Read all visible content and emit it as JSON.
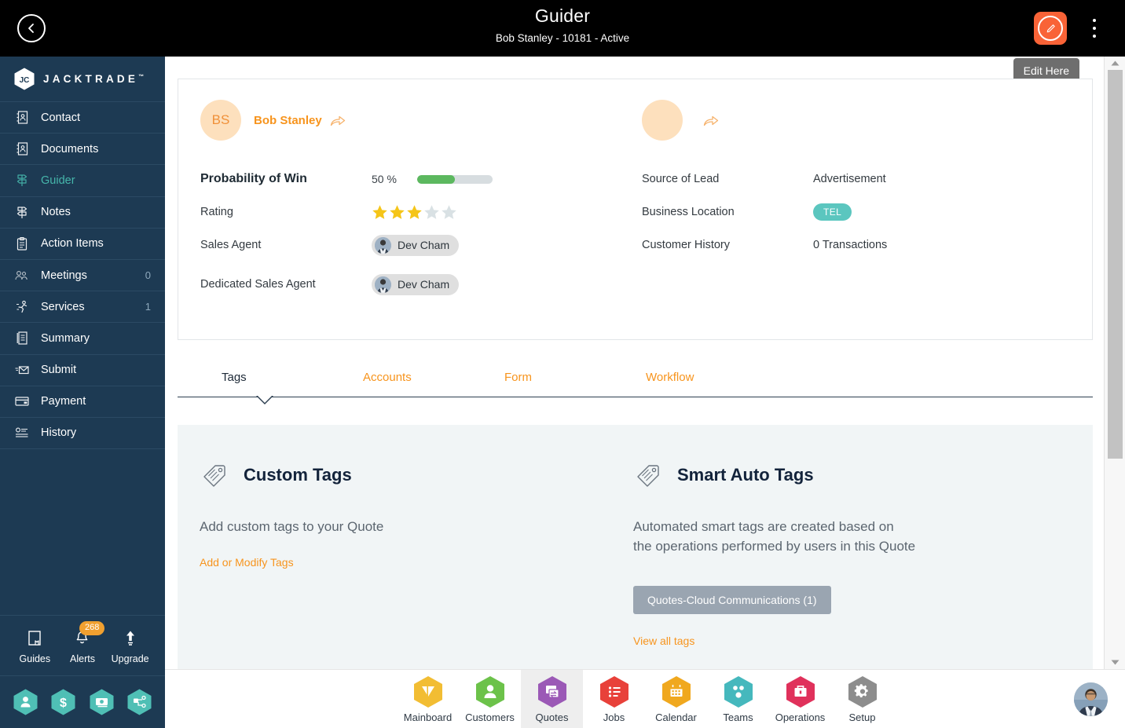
{
  "topbar": {
    "back_icon": "chevron-left-circle-icon",
    "title": "Guider",
    "subtitle": "Bob Stanley - 10181 - Active",
    "edit_icon": "pencil-circle-icon",
    "menu_icon": "kebab-menu-icon",
    "edit_highlight_color": "#f96337"
  },
  "tooltip": {
    "edit_here": "Edit Here"
  },
  "sidebar": {
    "brand": "JACKTRADE",
    "brand_tm": "™",
    "accent_active": "#46b6ab",
    "background": "#1d3a53",
    "items": [
      {
        "label": "Contact",
        "icon": "contact-book-icon",
        "count": "",
        "active": false
      },
      {
        "label": "Documents",
        "icon": "documents-icon",
        "count": "",
        "active": false
      },
      {
        "label": "Guider",
        "icon": "signpost-icon",
        "count": "",
        "active": true
      },
      {
        "label": "Notes",
        "icon": "signpost-icon",
        "count": "",
        "active": false
      },
      {
        "label": "Action Items",
        "icon": "clipboard-icon",
        "count": "",
        "active": false
      },
      {
        "label": "Meetings",
        "icon": "meetings-icon",
        "count": "0",
        "active": false
      },
      {
        "label": "Services",
        "icon": "services-runner-icon",
        "count": "1",
        "active": false
      },
      {
        "label": "Summary",
        "icon": "summary-doc-icon",
        "count": "",
        "active": false
      },
      {
        "label": "Submit",
        "icon": "submit-envelope-icon",
        "count": "",
        "active": false
      },
      {
        "label": "Payment",
        "icon": "payment-card-icon",
        "count": "",
        "active": false
      },
      {
        "label": "History",
        "icon": "history-list-icon",
        "count": "",
        "active": false
      }
    ],
    "tools": [
      {
        "label": "Guides",
        "icon": "book-icon",
        "badge": ""
      },
      {
        "label": "Alerts",
        "icon": "bell-icon",
        "badge": "268"
      },
      {
        "label": "Upgrade",
        "icon": "upward-arrow-icon",
        "badge": ""
      }
    ],
    "quick_hexes": [
      {
        "icon": "person-icon"
      },
      {
        "icon": "dollar-icon"
      },
      {
        "icon": "money-transfer-icon"
      },
      {
        "icon": "workflow-nodes-icon"
      }
    ]
  },
  "card": {
    "person": {
      "initials": "BS",
      "name": "Bob Stanley",
      "share_icon": "share-arrow-icon",
      "avatar_bg": "#fde0bd"
    },
    "person_secondary": {
      "initials": "",
      "name": "",
      "share_icon": "share-arrow-icon"
    },
    "left_fields": [
      {
        "label": "Probability of Win",
        "type": "progress",
        "value_text": "50 %",
        "percent": 50,
        "bar_color": "#5cb85f"
      },
      {
        "label": "Rating",
        "type": "stars",
        "filled": 3,
        "total": 5,
        "star_color": "#f5c518"
      },
      {
        "label": "Sales Agent",
        "type": "chip",
        "value_text": "Dev Cham"
      },
      {
        "label": "Dedicated Sales Agent",
        "type": "chip",
        "value_text": "Dev Cham"
      }
    ],
    "right_fields": [
      {
        "label": "Source of Lead",
        "type": "text",
        "value_text": "Advertisement"
      },
      {
        "label": "Business Location",
        "type": "badge",
        "value_text": "TEL",
        "badge_color": "#5bc6bf"
      },
      {
        "label": "Customer History",
        "type": "text",
        "value_text": "0 Transactions"
      }
    ]
  },
  "tabs": [
    {
      "label": "Tags",
      "active": true
    },
    {
      "label": "Accounts",
      "active": false
    },
    {
      "label": "Form",
      "active": false
    },
    {
      "label": "Workflow",
      "active": false
    }
  ],
  "tags_panel": {
    "custom": {
      "icon": "tag-icon",
      "title": "Custom Tags",
      "description": "Add custom tags to your Quote",
      "link": "Add or Modify Tags"
    },
    "smart": {
      "icon": "tag-icon",
      "title": "Smart Auto Tags",
      "description": "Automated smart tags are created based on the operations performed by users in this Quote",
      "chips": [
        "Quotes-Cloud Communications (1)"
      ],
      "link": "View all tags"
    }
  },
  "scrollbar": {
    "up_icon": "scroll-up-arrow-icon",
    "down_icon": "scroll-down-arrow-icon"
  },
  "bottom_nav": {
    "items": [
      {
        "label": "Mainboard",
        "icon": "mainboard-icon",
        "color": "#f2bd33",
        "selected": false
      },
      {
        "label": "Customers",
        "icon": "customers-icon",
        "color": "#6cc24a",
        "selected": false
      },
      {
        "label": "Quotes",
        "icon": "quotes-icon",
        "color": "#9b59b6",
        "selected": true
      },
      {
        "label": "Jobs",
        "icon": "jobs-icon",
        "color": "#e8413a",
        "selected": false
      },
      {
        "label": "Calendar",
        "icon": "calendar-icon",
        "color": "#f0a81e",
        "selected": false
      },
      {
        "label": "Teams",
        "icon": "teams-icon",
        "color": "#45b8bd",
        "selected": false
      },
      {
        "label": "Operations",
        "icon": "operations-icon",
        "color": "#e0315b",
        "selected": false
      },
      {
        "label": "Setup",
        "icon": "setup-gear-icon",
        "color": "#8d8d8d",
        "selected": false
      }
    ],
    "user_avatar": "user-avatar-icon"
  }
}
